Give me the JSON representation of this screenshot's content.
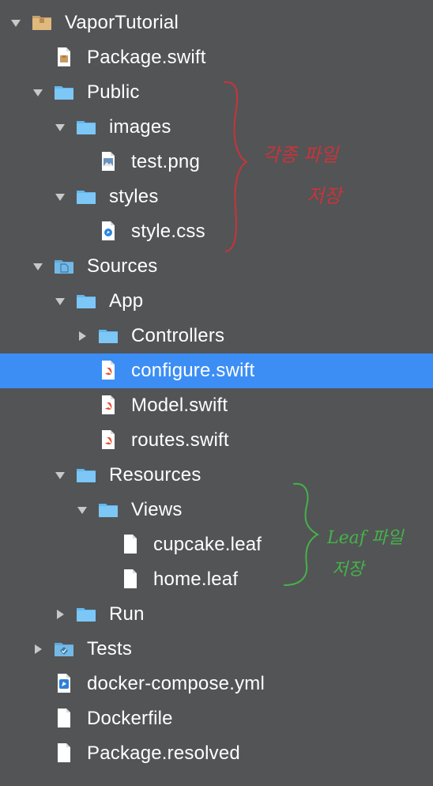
{
  "tree": [
    {
      "label": "VaporTutorial",
      "icon": "package-folder-icon",
      "chevron": "down"
    },
    {
      "label": "Package.swift",
      "icon": "swift-package-file-icon",
      "chevron": "none"
    },
    {
      "label": "Public",
      "icon": "folder-icon",
      "chevron": "down"
    },
    {
      "label": "images",
      "icon": "folder-icon",
      "chevron": "down"
    },
    {
      "label": "test.png",
      "icon": "image-file-icon",
      "chevron": "none"
    },
    {
      "label": "styles",
      "icon": "folder-icon",
      "chevron": "down"
    },
    {
      "label": "style.css",
      "icon": "css-file-icon",
      "chevron": "none"
    },
    {
      "label": "Sources",
      "icon": "sources-folder-icon",
      "chevron": "down"
    },
    {
      "label": "App",
      "icon": "folder-icon",
      "chevron": "down"
    },
    {
      "label": "Controllers",
      "icon": "folder-icon",
      "chevron": "right"
    },
    {
      "label": "configure.swift",
      "icon": "swift-file-icon",
      "chevron": "none",
      "selected": true
    },
    {
      "label": "Model.swift",
      "icon": "swift-file-icon",
      "chevron": "none"
    },
    {
      "label": "routes.swift",
      "icon": "swift-file-icon",
      "chevron": "none"
    },
    {
      "label": "Resources",
      "icon": "folder-icon",
      "chevron": "down"
    },
    {
      "label": "Views",
      "icon": "folder-icon",
      "chevron": "down"
    },
    {
      "label": "cupcake.leaf",
      "icon": "blank-file-icon",
      "chevron": "none"
    },
    {
      "label": "home.leaf",
      "icon": "blank-file-icon",
      "chevron": "none"
    },
    {
      "label": "Run",
      "icon": "folder-icon",
      "chevron": "right"
    },
    {
      "label": "Tests",
      "icon": "tests-folder-icon",
      "chevron": "right"
    },
    {
      "label": "docker-compose.yml",
      "icon": "yml-file-icon",
      "chevron": "none"
    },
    {
      "label": "Dockerfile",
      "icon": "blank-file-icon",
      "chevron": "none"
    },
    {
      "label": "Package.resolved",
      "icon": "blank-file-icon",
      "chevron": "none"
    }
  ],
  "annotations": {
    "public_note_line1": "각종 파일",
    "public_note_line2": "저장",
    "views_note_line1": "Leaf 파일",
    "views_note_line2": "저장"
  },
  "colors": {
    "background": "#535456",
    "selection": "#3c8ef5",
    "folder": "#63b8ef",
    "red_annotation": "#c8343a",
    "green_annotation": "#45b24a"
  }
}
